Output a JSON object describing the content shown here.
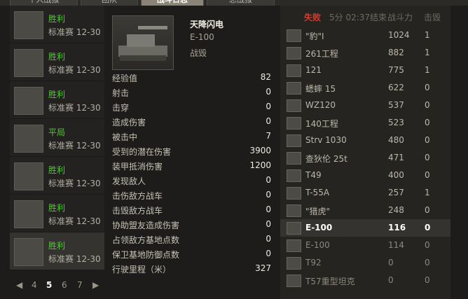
{
  "tabs": [
    "个人战报",
    "团队",
    "战斗日志",
    "总战报"
  ],
  "battles": [
    {
      "result": "胜利",
      "mode": "标准赛 12-30",
      "result_color": "#54c63a"
    },
    {
      "result": "胜利",
      "mode": "标准赛 12-30",
      "result_color": "#54c63a"
    },
    {
      "result": "胜利",
      "mode": "标准赛 12-30",
      "result_color": "#54c63a"
    },
    {
      "result": "平局",
      "mode": "标准赛 12-30",
      "result_color": "#54c63a"
    },
    {
      "result": "胜利",
      "mode": "标准赛 12-30",
      "result_color": "#54c63a"
    },
    {
      "result": "胜利",
      "mode": "标准赛 12-30",
      "result_color": "#54c63a"
    },
    {
      "result": "胜利",
      "mode": "标准赛 12-30",
      "result_color": "#54c63a"
    }
  ],
  "pager": [
    "4",
    "5",
    "6",
    "7"
  ],
  "pager_current": "5",
  "vehicle": {
    "player": "天降闪电",
    "tank": "E-100",
    "status": "战毁"
  },
  "stats": [
    {
      "label": "经验值",
      "value": "82"
    },
    {
      "label": "射击",
      "value": "0"
    },
    {
      "label": "击穿",
      "value": "0"
    },
    {
      "label": "造成伤害",
      "value": "0"
    },
    {
      "label": "被击中",
      "value": "7"
    },
    {
      "label": "受到的潜在伤害",
      "value": "3900"
    },
    {
      "label": "装甲抵消伤害",
      "value": "1200"
    },
    {
      "label": "发现敌人",
      "value": "0"
    },
    {
      "label": "击伤敌方战车",
      "value": "0"
    },
    {
      "label": "击毁敌方战车",
      "value": "0"
    },
    {
      "label": "协助盟友造成伤害",
      "value": "0"
    },
    {
      "label": "占领敌方基地点数",
      "value": "0"
    },
    {
      "label": "保卫基地防御点数",
      "value": "0"
    },
    {
      "label": "行驶里程（米）",
      "value": "327"
    }
  ],
  "team_header": {
    "result": "失败",
    "time": "5分 02:37结束",
    "power": "战斗力",
    "kills": "击毁"
  },
  "players": [
    {
      "name": "\"豹\"I",
      "power": "1024",
      "kills": "1"
    },
    {
      "name": "261工程",
      "power": "882",
      "kills": "1"
    },
    {
      "name": "121",
      "power": "775",
      "kills": "1"
    },
    {
      "name": "蟋蟀 15",
      "power": "622",
      "kills": "0"
    },
    {
      "name": "WZ120",
      "power": "537",
      "kills": "0"
    },
    {
      "name": "140工程",
      "power": "523",
      "kills": "0"
    },
    {
      "name": "Strv 1030",
      "power": "480",
      "kills": "0"
    },
    {
      "name": "查狄伦 25t",
      "power": "471",
      "kills": "0"
    },
    {
      "name": "T49",
      "power": "400",
      "kills": "0"
    },
    {
      "name": "T-55A",
      "power": "257",
      "kills": "1"
    },
    {
      "name": "\"猎虎\"",
      "power": "248",
      "kills": "0"
    },
    {
      "name": "E-100",
      "power": "116",
      "kills": "0"
    },
    {
      "name": "E-100",
      "power": "114",
      "kills": "0"
    },
    {
      "name": "T92",
      "power": "0",
      "kills": "0"
    },
    {
      "name": "T57重型坦克",
      "power": "0",
      "kills": "0"
    }
  ]
}
